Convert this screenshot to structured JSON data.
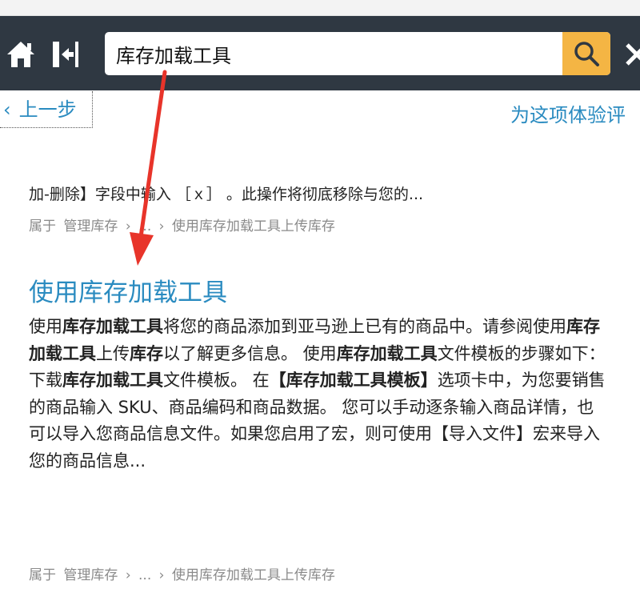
{
  "header": {
    "search_value": "库存加载工具",
    "home_icon": "home-icon",
    "collapse_icon": "collapse-panel-icon",
    "search_icon": "search-icon",
    "close_icon": "close-icon",
    "accent_color": "#f4b544",
    "bar_color": "#2f3842"
  },
  "nav": {
    "back_chevron": "‹",
    "back_label": "上一步",
    "feedback_label": "为这项体验评"
  },
  "results": [
    {
      "snippet": "加-删除】字段中输入 ［ｘ］ 。此操作将彻底移除与您的...",
      "breadcrumb": [
        "属于",
        "管理库存",
        "›",
        "...",
        "›",
        "使用库存加载工具上传库存"
      ]
    },
    {
      "title": "使用库存加载工具",
      "body": [
        {
          "t": "使用",
          "b": false
        },
        {
          "t": "库存加载工具",
          "b": true
        },
        {
          "t": "将您的商品添加到亚马逊上已有的商品中。请参阅使用",
          "b": false
        },
        {
          "t": "库存加载工具",
          "b": true
        },
        {
          "t": "上传",
          "b": false
        },
        {
          "t": "库存",
          "b": true
        },
        {
          "t": "以了解更多信息。 使用",
          "b": false
        },
        {
          "t": "库存加载工具",
          "b": true
        },
        {
          "t": "文件模板的步骤如下： 下载",
          "b": false
        },
        {
          "t": "库存加载工具",
          "b": true
        },
        {
          "t": "文件模板。 在",
          "b": false
        },
        {
          "t": "【库存加载工具模板】",
          "b": true
        },
        {
          "t": "选项卡中，为您要销售的商品输入 SKU、商品编码和商品数据。 您可以手动逐条输入商品详情，也可以导入您商品信息文件。如果您启用了宏，则可使用【导入文件】宏来导入您的商品信息...",
          "b": false
        }
      ],
      "breadcrumb": [
        "属于",
        "管理库存",
        "›",
        "...",
        "›",
        "使用库存加载工具上传库存"
      ]
    }
  ]
}
